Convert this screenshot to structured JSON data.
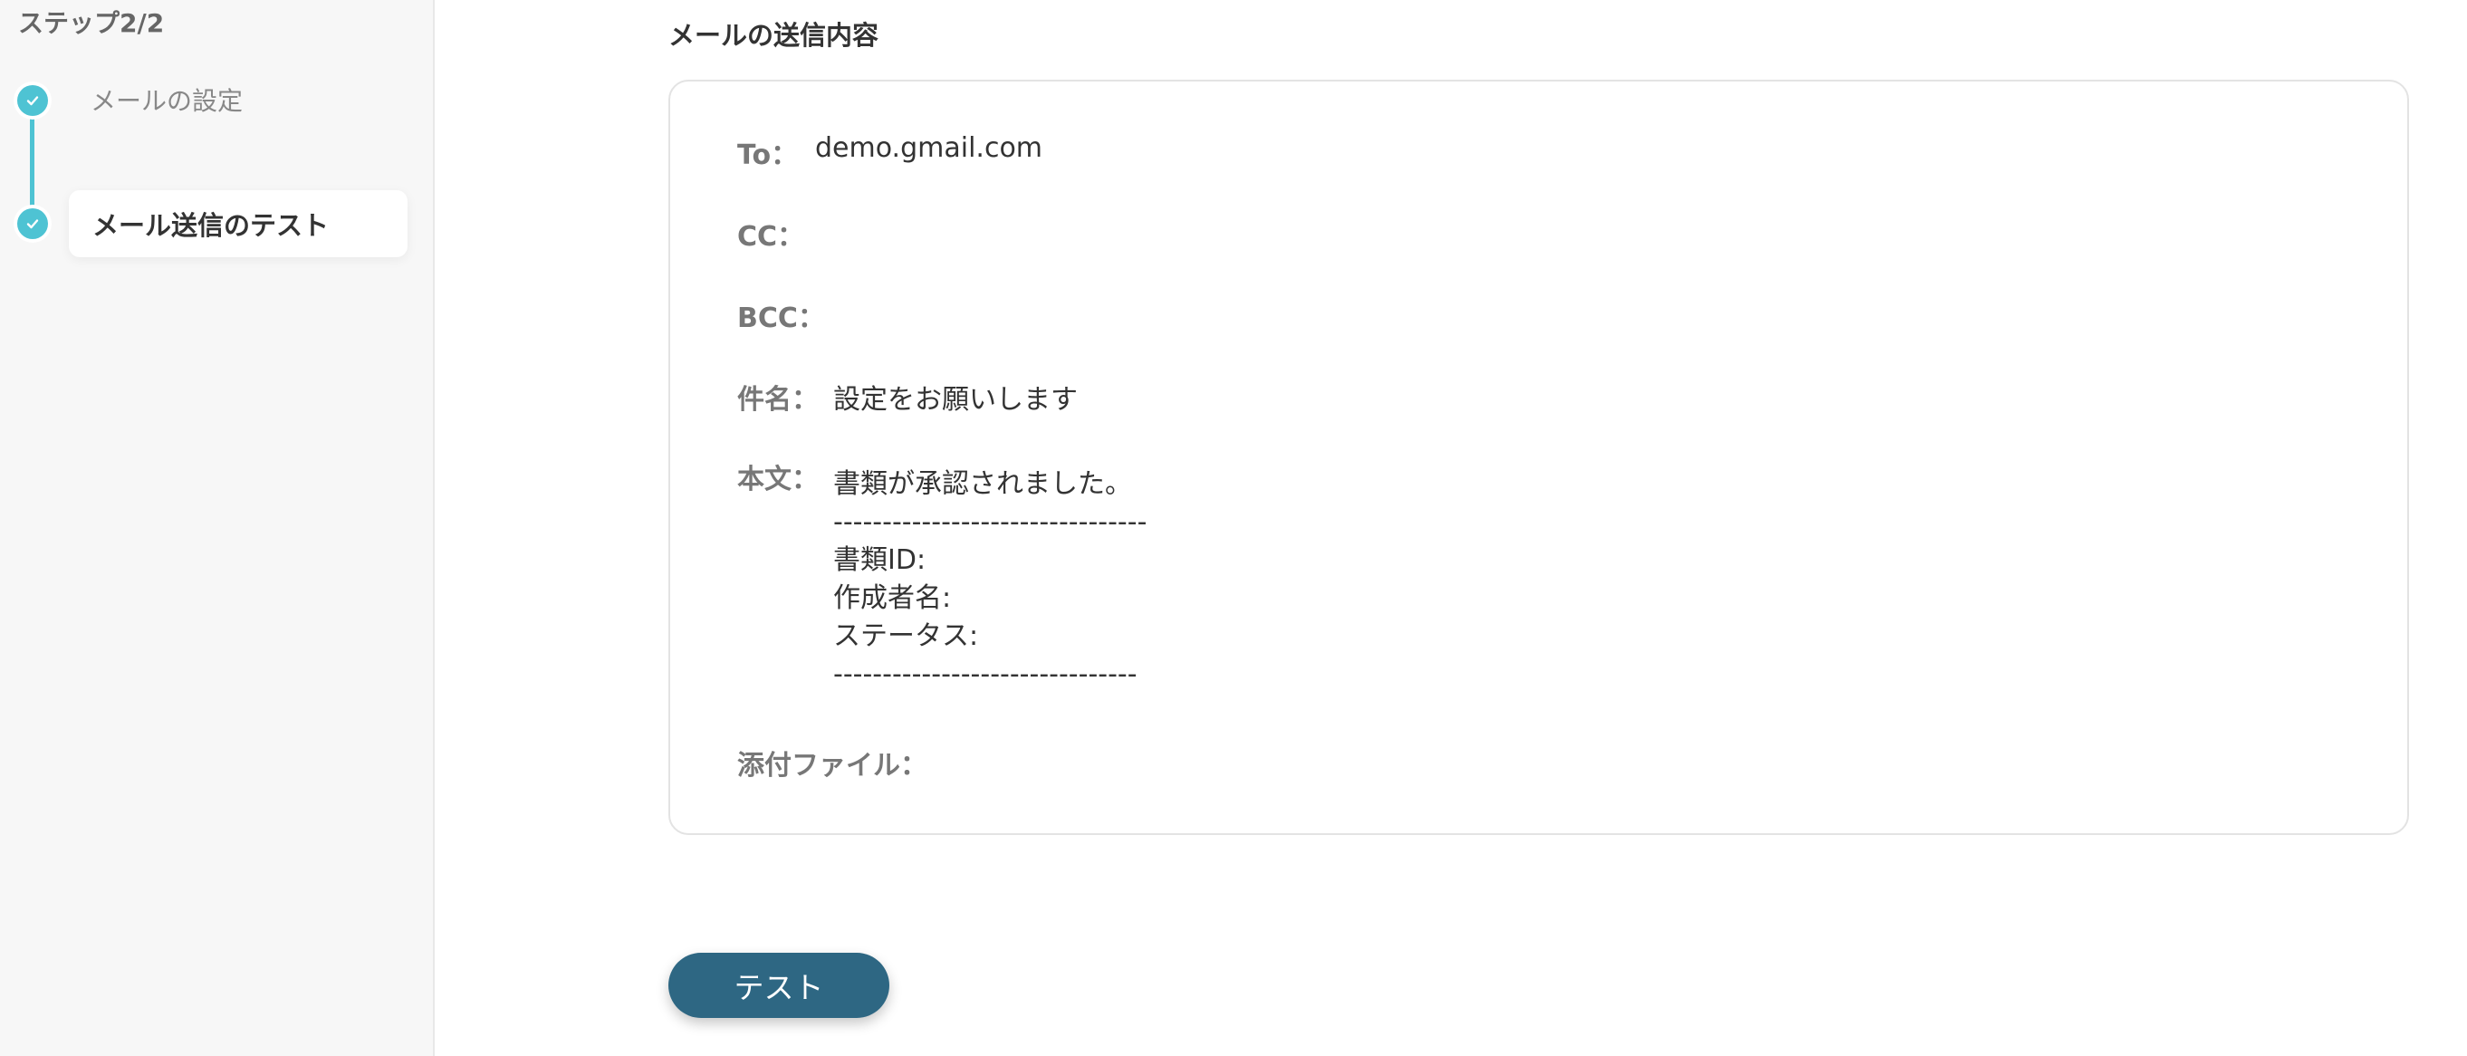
{
  "sidebar": {
    "step_header": "ステップ2/2",
    "steps": [
      {
        "label": "メールの設定",
        "status": "completed",
        "active": false
      },
      {
        "label": "メール送信のテスト",
        "status": "completed",
        "active": true
      }
    ],
    "accent_color": "#4ec3d3"
  },
  "main": {
    "section_title": "メールの送信内容",
    "mail": {
      "to_label": "To：",
      "to_value": "demo.gmail.com",
      "cc_label": "CC：",
      "bcc_label": "BCC：",
      "subject_label": "件名：",
      "subject_value": "設定をお願いします",
      "body_label": "本文：",
      "body_lines": [
        "書類が承認されました。",
        "--------------------------------",
        "書類ID:",
        "作成者名:",
        "ステータス:",
        "-------------------------------"
      ],
      "attachment_label": "添付ファイル："
    },
    "test_button_label": "テスト",
    "button_color": "#2e6783"
  }
}
